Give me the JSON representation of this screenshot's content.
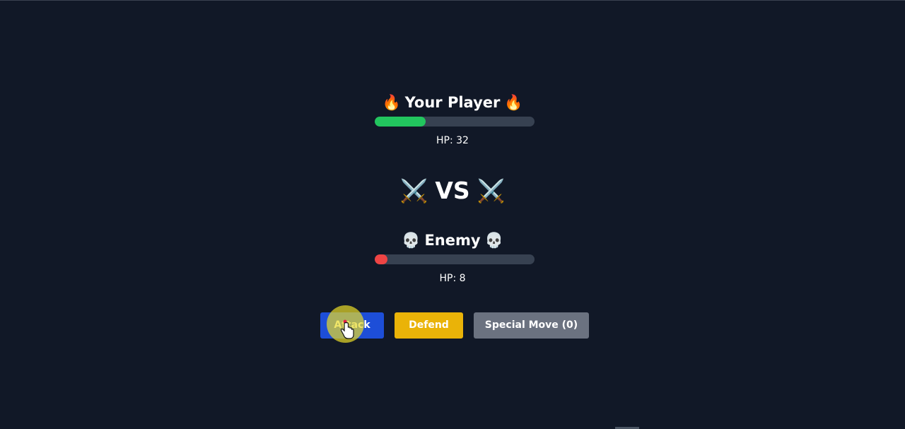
{
  "player": {
    "title": "Your Player",
    "emoji": "🔥",
    "hp_label": "HP: 32",
    "hp_fraction": 0.32,
    "bar_color": "#22c55e"
  },
  "versus": {
    "text": "VS",
    "emoji": "⚔️"
  },
  "enemy": {
    "title": "Enemy",
    "emoji": "💀",
    "hp_label": "HP: 8",
    "hp_fraction": 0.08,
    "bar_color": "#ef4444"
  },
  "actions": {
    "attack_label": "Attack",
    "defend_label": "Defend",
    "special_label": "Special Move (0)"
  },
  "colors": {
    "background": "#111827",
    "track": "#374151",
    "attack": "#1d4ed8",
    "defend": "#eab308",
    "special": "#6b7280"
  }
}
